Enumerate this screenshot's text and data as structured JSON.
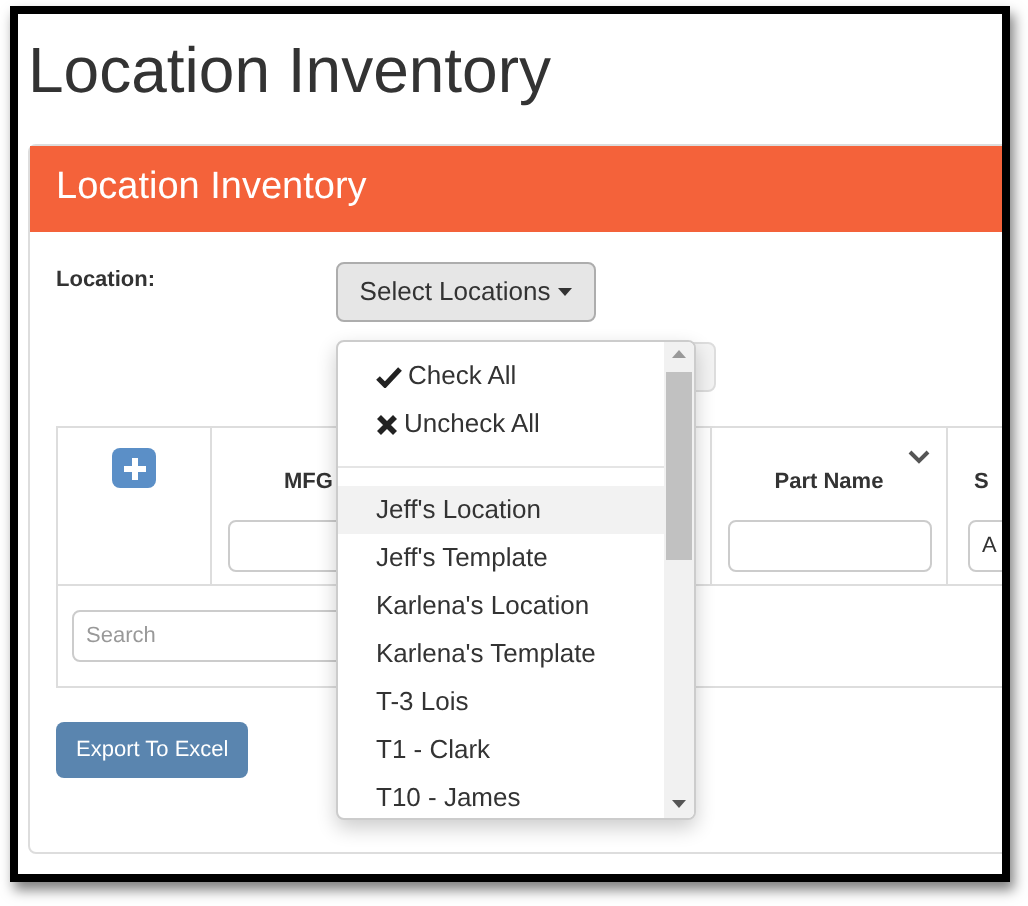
{
  "page_title": "Location Inventory",
  "panel": {
    "title": "Location Inventory",
    "location_label": "Location:",
    "select_button": "Select Locations",
    "table": {
      "columns": [
        {
          "label": "MFG"
        },
        {
          "label": "Part Name"
        },
        {
          "label": "S",
          "filter_value": "A"
        }
      ],
      "search_placeholder": "Search"
    },
    "export_button": "Export To Excel"
  },
  "dropdown": {
    "actions": [
      {
        "kind": "check",
        "label": "Check All"
      },
      {
        "kind": "uncheck",
        "label": "Uncheck All"
      }
    ],
    "options": [
      {
        "label": "Jeff's Location",
        "selected": true
      },
      {
        "label": "Jeff's Template",
        "selected": false
      },
      {
        "label": "Karlena's Location",
        "selected": false
      },
      {
        "label": "Karlena's Template",
        "selected": false
      },
      {
        "label": "T-3 Lois",
        "selected": false
      },
      {
        "label": "T1 - Clark",
        "selected": false
      },
      {
        "label": "T10 - James",
        "selected": false
      }
    ]
  }
}
